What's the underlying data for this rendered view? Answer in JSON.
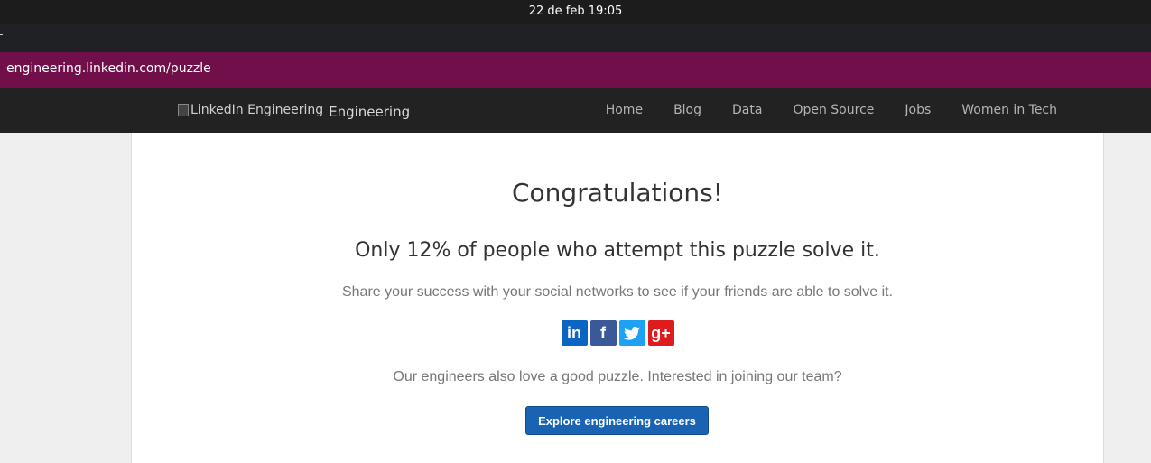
{
  "system_bar": {
    "clock": "22 de feb  19:05"
  },
  "browser": {
    "url": "engineering.linkedin.com/puzzle"
  },
  "site_nav": {
    "logo_alt": "LinkedIn Engineering",
    "brand_text": "Engineering",
    "links": [
      "Home",
      "Blog",
      "Data",
      "Open Source",
      "Jobs",
      "Women in Tech"
    ]
  },
  "main": {
    "heading": "Congratulations!",
    "subheading": "Only 12% of people who attempt this puzzle solve it.",
    "share_text": "Share your success with your social networks to see if your friends are able to solve it.",
    "social": [
      {
        "name": "linkedin-icon",
        "glyph": "in",
        "color": "#0a66c2"
      },
      {
        "name": "facebook-icon",
        "glyph": "f",
        "color": "#3b5998"
      },
      {
        "name": "twitter-icon",
        "glyph": "🐦",
        "color": "#1da1f2"
      },
      {
        "name": "google-plus-icon",
        "glyph": "g+",
        "color": "#dd1d1d"
      }
    ],
    "join_text": "Our engineers also love a good puzzle. Interested in joining our team?",
    "cta_label": "Explore engineering careers"
  },
  "colors": {
    "url_bar": "#700f4a",
    "nav_bg": "#222222",
    "cta": "#1a63b2"
  }
}
